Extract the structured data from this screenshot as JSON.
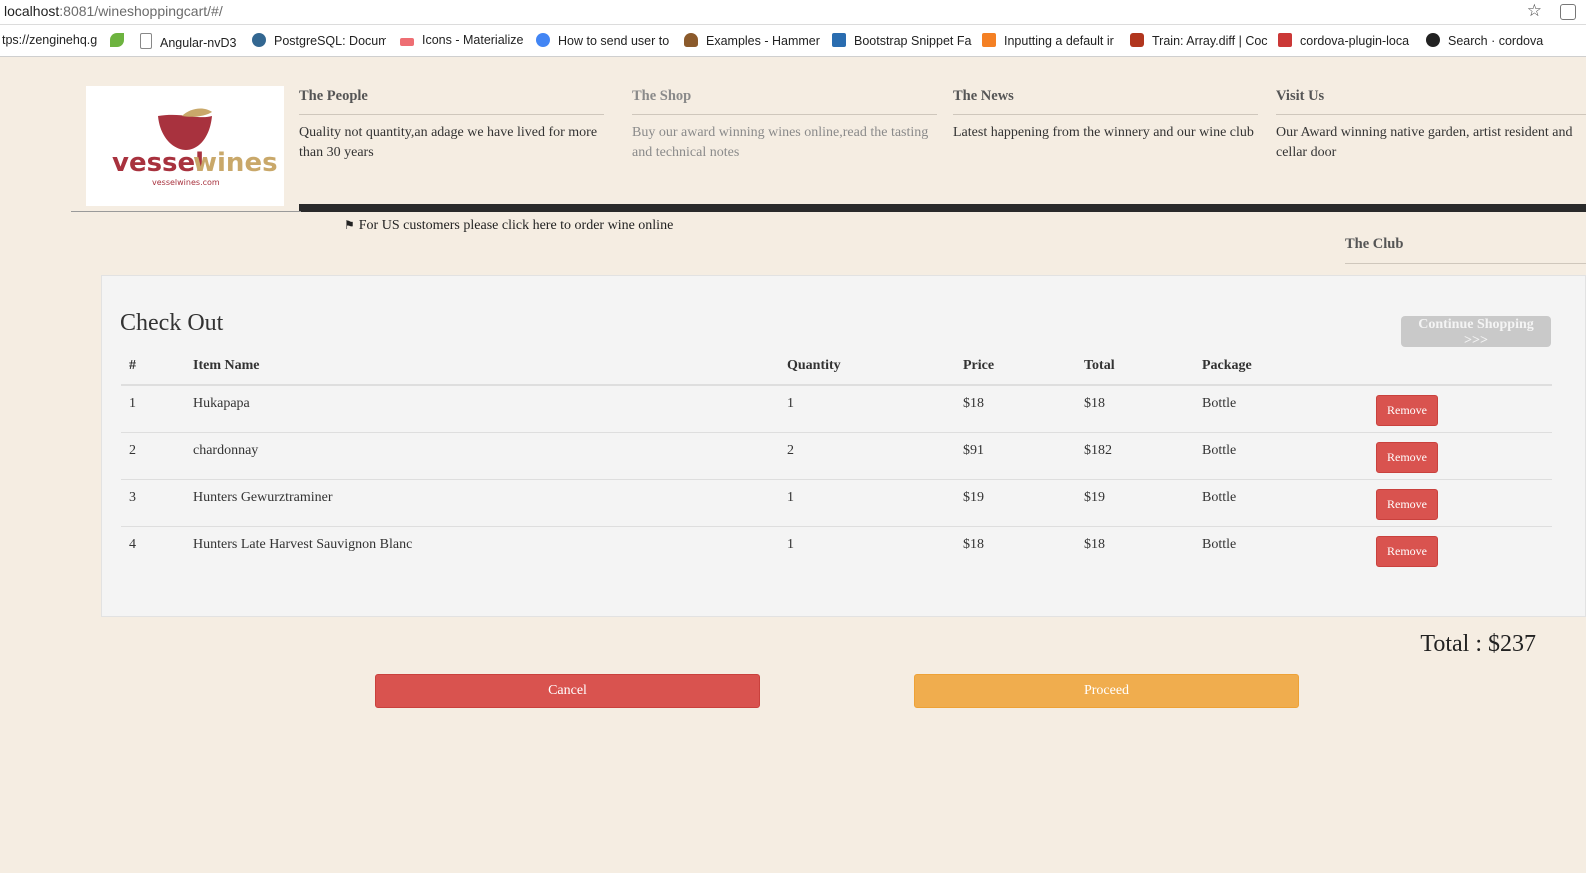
{
  "browser": {
    "url_host": "localhost",
    "url_path": ":8081/wineshoppingcart/#/",
    "bookmarks": [
      {
        "label": "tps://zenginehq.gi",
        "icon": "page-icon",
        "color": "#ffffff"
      },
      {
        "label": "",
        "icon": "leaf-icon",
        "color": "#6db33f"
      },
      {
        "label": "Angular-nvD3",
        "icon": "page-icon",
        "color": "#ffffff"
      },
      {
        "label": "PostgreSQL: Docume",
        "icon": "elephant-icon",
        "color": "#336791"
      },
      {
        "label": "Icons - Materialize",
        "icon": "materialize-icon",
        "color": "#ee6e73"
      },
      {
        "label": "How to send user to",
        "icon": "globe-icon",
        "color": "#4285f4"
      },
      {
        "label": "Examples - Hammer",
        "icon": "hammer-icon",
        "color": "#8b5a2b"
      },
      {
        "label": "Bootstrap Snippet Fa",
        "icon": "bootstrap-icon",
        "color": "#2a6db0"
      },
      {
        "label": "Inputting a default ir",
        "icon": "stackoverflow-icon",
        "color": "#f48024"
      },
      {
        "label": "Train: Array.diff | Coc",
        "icon": "codewars-icon",
        "color": "#b1361e"
      },
      {
        "label": "cordova-plugin-loca",
        "icon": "npm-icon",
        "color": "#cb3837"
      },
      {
        "label": "Search · cordova",
        "icon": "github-icon",
        "color": "#222222"
      }
    ]
  },
  "header": {
    "logo_text_a": "vessel",
    "logo_text_b": "wines",
    "logo_sub": "vesselwines.com",
    "nav": [
      {
        "title": "The People",
        "desc": "Quality not quantity,an adage we have lived for more than 30 years"
      },
      {
        "title": "The Shop",
        "desc": "Buy our award winning wines online,read the tasting and technical notes"
      },
      {
        "title": "The News",
        "desc": "Latest happening from the winnery and our wine club"
      },
      {
        "title": "Visit Us",
        "desc": "Our Award winning native garden, artist resident and cellar door"
      }
    ],
    "us_note": "For US customers please click here to order wine online",
    "club": "The Club"
  },
  "checkout": {
    "title": "Check Out",
    "continue_label": "Continue Shopping >>>",
    "columns": [
      "#",
      "Item Name",
      "Quantity",
      "Price",
      "Total",
      "Package"
    ],
    "rows": [
      {
        "num": "1",
        "name": "Hukapapa",
        "qty": "1",
        "price": "$18",
        "total": "$18",
        "package": "Bottle",
        "action": "Remove"
      },
      {
        "num": "2",
        "name": "chardonnay",
        "qty": "2",
        "price": "$91",
        "total": "$182",
        "package": "Bottle",
        "action": "Remove"
      },
      {
        "num": "3",
        "name": "Hunters Gewurztraminer",
        "qty": "1",
        "price": "$19",
        "total": "$19",
        "package": "Bottle",
        "action": "Remove"
      },
      {
        "num": "4",
        "name": "Hunters Late Harvest Sauvignon Blanc",
        "qty": "1",
        "price": "$18",
        "total": "$18",
        "package": "Bottle",
        "action": "Remove"
      }
    ],
    "grand_total": "Total : $237",
    "cancel_label": "Cancel",
    "proceed_label": "Proceed"
  },
  "colors": {
    "page_bg": "#f5ede2",
    "danger": "#d9534f",
    "warning": "#f0ad4e",
    "logo_red": "#a8323e",
    "logo_gold": "#c9a86a"
  }
}
